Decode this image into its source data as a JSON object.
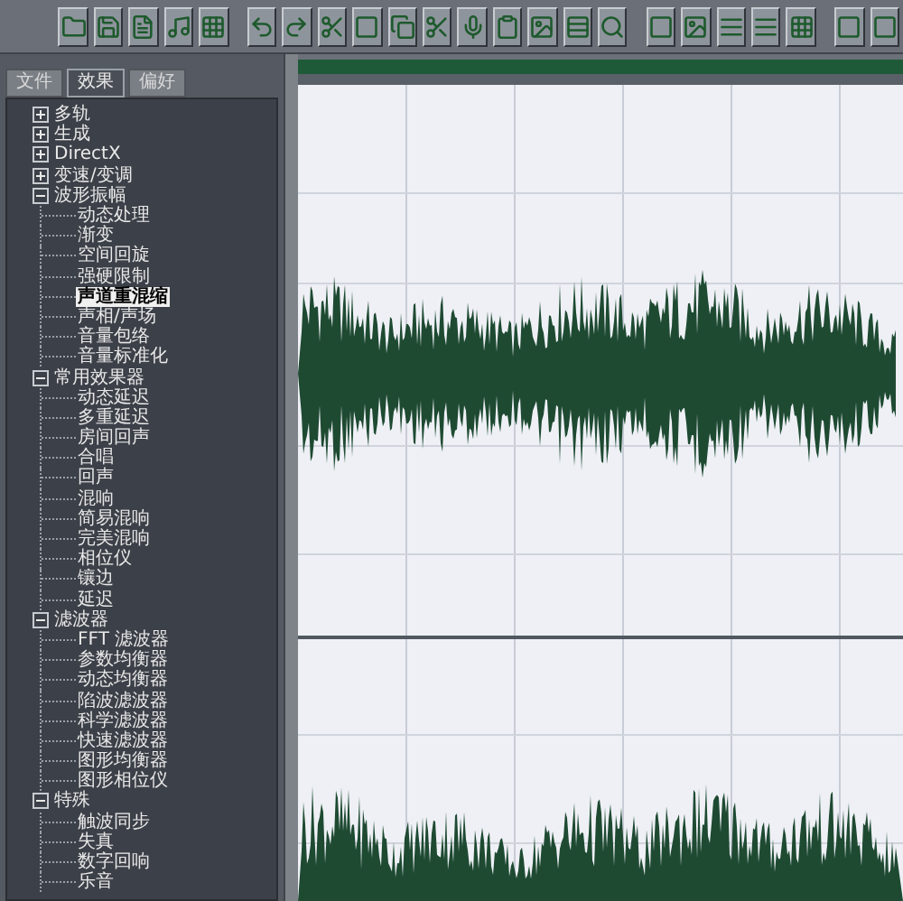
{
  "tabs": [
    {
      "label": "文件",
      "selected": false
    },
    {
      "label": "效果",
      "selected": true
    },
    {
      "label": "偏好",
      "selected": false
    }
  ],
  "tree": [
    {
      "label": "多轨",
      "expanded": false
    },
    {
      "label": "生成",
      "expanded": false
    },
    {
      "label": "DirectX",
      "expanded": false
    },
    {
      "label": "变速/变调",
      "expanded": false
    },
    {
      "label": "波形振幅",
      "expanded": true,
      "children": [
        {
          "label": "动态处理",
          "selected": false
        },
        {
          "label": "渐变",
          "selected": false
        },
        {
          "label": "空间回旋",
          "selected": false
        },
        {
          "label": "强硬限制",
          "selected": false
        },
        {
          "label": "声道重混缩",
          "selected": true
        },
        {
          "label": "声相/声场",
          "selected": false
        },
        {
          "label": "音量包络",
          "selected": false
        },
        {
          "label": "音量标准化",
          "selected": false
        }
      ]
    },
    {
      "label": "常用效果器",
      "expanded": true,
      "children": [
        {
          "label": "动态延迟",
          "selected": false
        },
        {
          "label": "多重延迟",
          "selected": false
        },
        {
          "label": "房间回声",
          "selected": false
        },
        {
          "label": "合唱",
          "selected": false
        },
        {
          "label": "回声",
          "selected": false
        },
        {
          "label": "混响",
          "selected": false
        },
        {
          "label": "简易混响",
          "selected": false
        },
        {
          "label": "完美混响",
          "selected": false
        },
        {
          "label": "相位仪",
          "selected": false
        },
        {
          "label": "镶边",
          "selected": false
        },
        {
          "label": "延迟",
          "selected": false
        }
      ]
    },
    {
      "label": "滤波器",
      "expanded": true,
      "children": [
        {
          "label": "FFT 滤波器",
          "selected": false
        },
        {
          "label": "参数均衡器",
          "selected": false
        },
        {
          "label": "动态均衡器",
          "selected": false
        },
        {
          "label": "陷波滤波器",
          "selected": false
        },
        {
          "label": "科学滤波器",
          "selected": false
        },
        {
          "label": "快速滤波器",
          "selected": false
        },
        {
          "label": "图形均衡器",
          "selected": false
        },
        {
          "label": "图形相位仪",
          "selected": false
        }
      ]
    },
    {
      "label": "特殊",
      "expanded": true,
      "children": [
        {
          "label": "触波同步",
          "selected": false
        },
        {
          "label": "失真",
          "selected": false
        },
        {
          "label": "数字回响",
          "selected": false
        },
        {
          "label": "乐音",
          "selected": false
        }
      ]
    }
  ]
}
